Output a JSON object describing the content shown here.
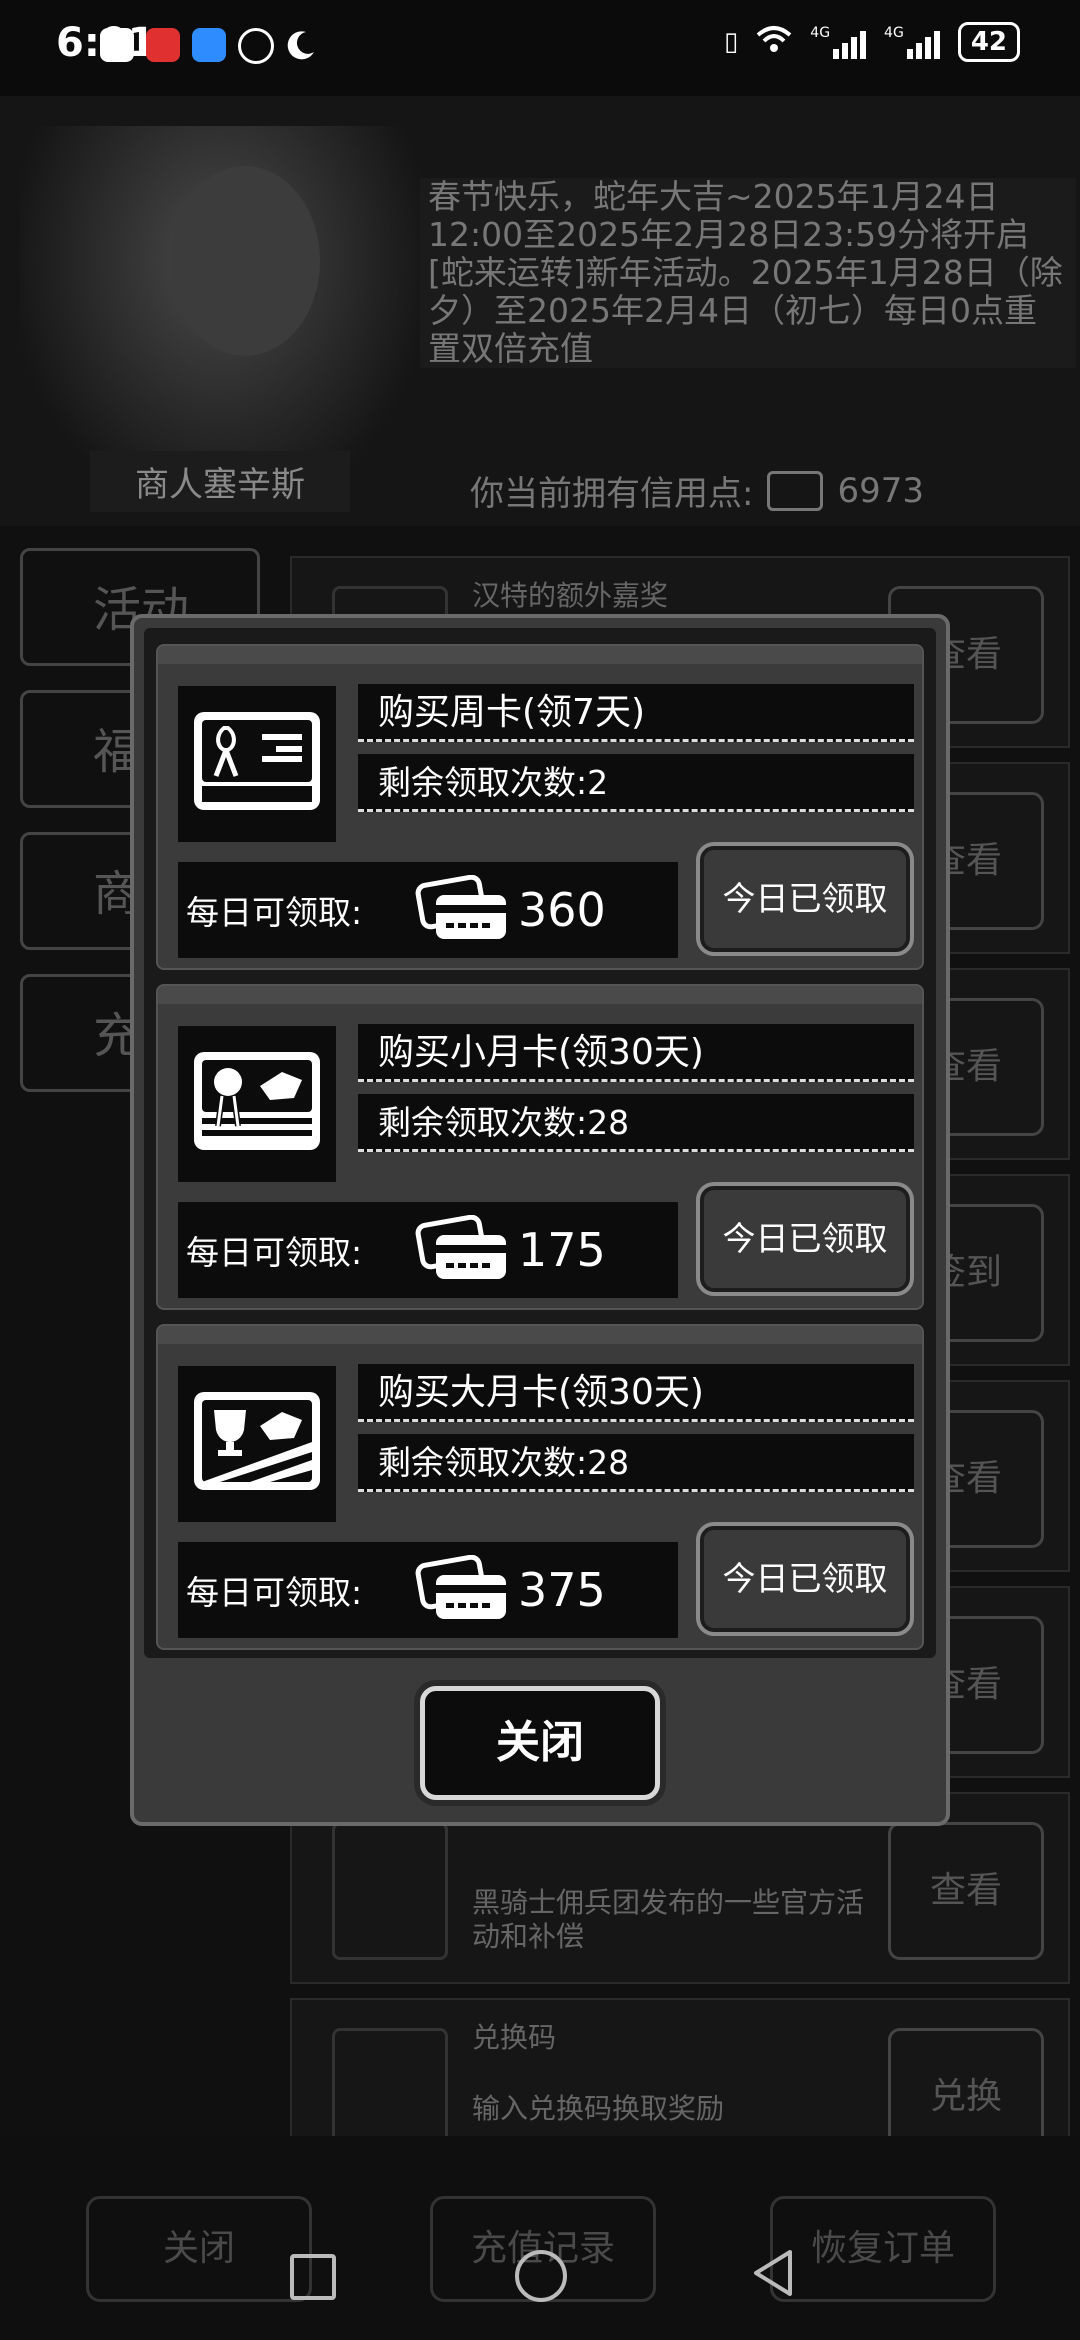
{
  "status_bar": {
    "time": "6:01",
    "battery": "42",
    "network1": "4G",
    "network2": "4G",
    "app_icons": [
      "qq-icon",
      "news-app-icon",
      "weather-icon",
      "alarm-icon",
      "moon-icon"
    ]
  },
  "npc": {
    "name": "商人塞辛斯",
    "speech": "春节快乐，蛇年大吉~2025年1月24日12:00至2025年2月28日23:59分将开启[蛇来运转]新年活动。2025年1月28日（除夕）至2025年2月4日（初七）每日0点重置双倍充值",
    "credits_label": "你当前拥有信用点:",
    "credits_value": "6973"
  },
  "tabs": [
    {
      "label": "活动"
    },
    {
      "label": "福"
    },
    {
      "label": "商"
    },
    {
      "label": "充"
    }
  ],
  "list": [
    {
      "title": "汉特的额外嘉奖",
      "desc": "",
      "button": "查看"
    },
    {
      "title": "",
      "desc": "",
      "button": "查看"
    },
    {
      "title": "",
      "desc": "",
      "button": "查看"
    },
    {
      "title": "",
      "desc": "",
      "button": "签到"
    },
    {
      "title": "",
      "desc": "",
      "button": "查看"
    },
    {
      "title": "",
      "desc": "",
      "button": "查看"
    },
    {
      "title": "",
      "desc": "黑骑士佣兵团发布的一些官方活动和补偿",
      "button": "查看"
    },
    {
      "title": "兑换码",
      "desc": "输入兑换码换取奖励",
      "button": "兑换"
    }
  ],
  "bottom_bar": {
    "close": "关闭",
    "history": "充值记录",
    "restore": "恢复订单"
  },
  "modal": {
    "cards": [
      {
        "title": "购买周卡(领7天)",
        "remain": "剩余领取次数:2",
        "daily_label": "每日可领取:",
        "daily_value": "360",
        "button": "今日已领取",
        "icon": "ribbon-card-icon"
      },
      {
        "title": "购买小月卡(领30天)",
        "remain": "剩余领取次数:28",
        "daily_label": "每日可领取:",
        "daily_value": "175",
        "button": "今日已领取",
        "icon": "medal-card-icon"
      },
      {
        "title": "购买大月卡(领30天)",
        "remain": "剩余领取次数:28",
        "daily_label": "每日可领取:",
        "daily_value": "375",
        "button": "今日已领取",
        "icon": "trophy-card-icon"
      }
    ],
    "close_button": "关闭"
  }
}
